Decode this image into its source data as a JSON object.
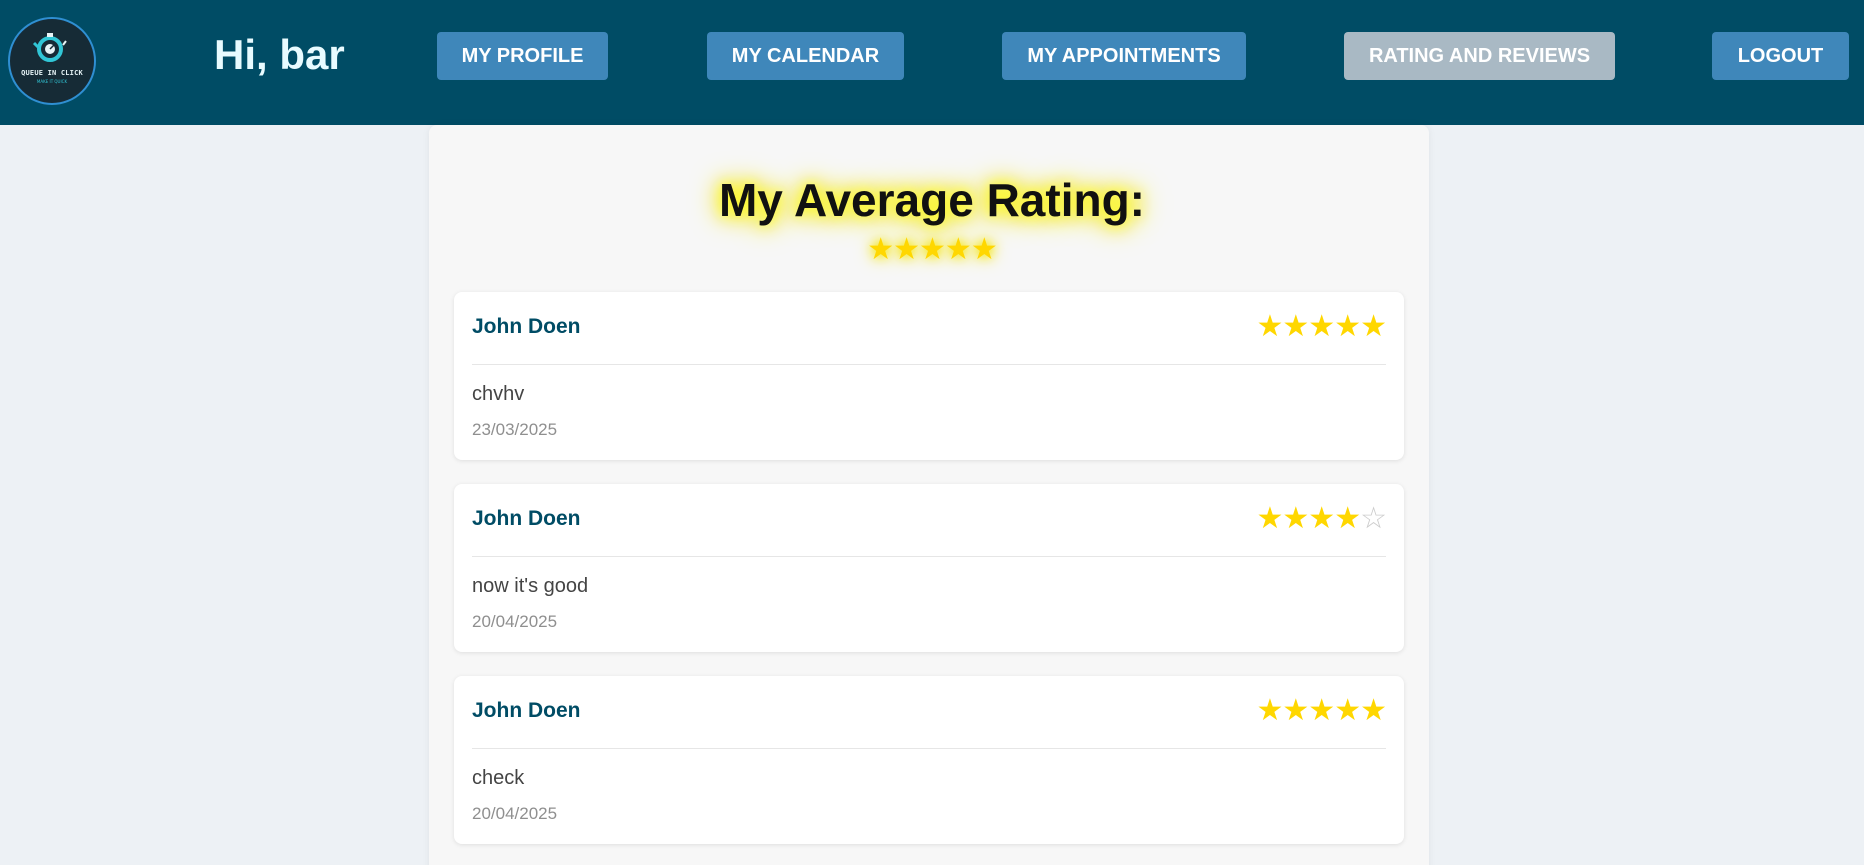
{
  "header": {
    "logo": {
      "title": "QUEUE IN CLICK",
      "subtitle": "MAKE IT QUICK",
      "icon": "stopwatch-icon"
    },
    "greeting": "Hi, bar",
    "nav": {
      "profile": "MY PROFILE",
      "calendar": "MY CALENDAR",
      "appointments": "MY APPOINTMENTS",
      "ratings": "RATING AND REVIEWS",
      "logout": "LOGOUT"
    },
    "active_nav": "ratings"
  },
  "average": {
    "title": "My Average Rating:",
    "rating": 5,
    "max": 5,
    "stars": "★★★★★"
  },
  "reviews": [
    {
      "name": "John Doen",
      "rating": 5,
      "stars_on": "★★★★★",
      "stars_off": "",
      "comment": "chvhv",
      "date": "23/03/2025"
    },
    {
      "name": "John Doen",
      "rating": 4,
      "stars_on": "★★★★",
      "stars_off": "☆",
      "comment": "now it's good",
      "date": "20/04/2025"
    },
    {
      "name": "John Doen",
      "rating": 5,
      "stars_on": "★★★★★",
      "stars_off": "",
      "comment": "check",
      "date": "20/04/2025"
    }
  ],
  "colors": {
    "header_bg": "#004c65",
    "nav_button": "#3f87ba",
    "nav_active": "#a9b9c4",
    "star": "#ffd700",
    "star_empty": "#cccccc",
    "name": "#004c65"
  }
}
